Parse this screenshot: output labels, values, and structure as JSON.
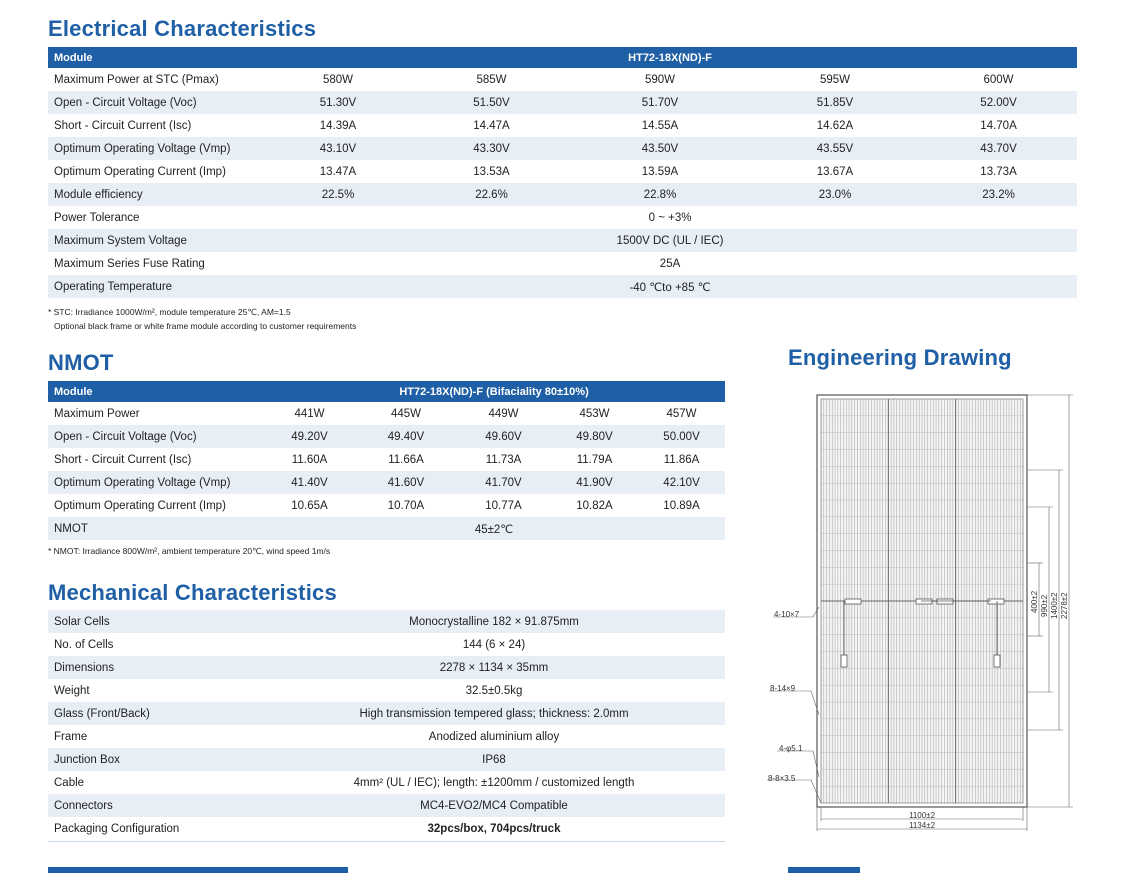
{
  "electrical": {
    "title": "Electrical Characteristics",
    "header": {
      "label": "Module",
      "model": "HT72-18X(ND)-F"
    },
    "rows": [
      {
        "label": "Maximum Power at STC (Pmax)",
        "values": [
          "580W",
          "585W",
          "590W",
          "595W",
          "600W"
        ]
      },
      {
        "label": "Open - Circuit Voltage (Voc)",
        "values": [
          "51.30V",
          "51.50V",
          "51.70V",
          "51.85V",
          "52.00V"
        ]
      },
      {
        "label": "Short - Circuit Current (Isc)",
        "values": [
          "14.39A",
          "14.47A",
          "14.55A",
          "14.62A",
          "14.70A"
        ]
      },
      {
        "label": "Optimum Operating Voltage (Vmp)",
        "values": [
          "43.10V",
          "43.30V",
          "43.50V",
          "43.55V",
          "43.70V"
        ]
      },
      {
        "label": "Optimum Operating Current (Imp)",
        "values": [
          "13.47A",
          "13.53A",
          "13.59A",
          "13.67A",
          "13.73A"
        ]
      },
      {
        "label": "Module efficiency",
        "values": [
          "22.5%",
          "22.6%",
          "22.8%",
          "23.0%",
          "23.2%"
        ]
      }
    ],
    "span_rows": [
      {
        "label": "Power Tolerance",
        "value": "0 ~ +3%"
      },
      {
        "label": "Maximum System Voltage",
        "value": "1500V DC (UL / IEC)"
      },
      {
        "label": "Maximum Series Fuse Rating",
        "value": "25A"
      },
      {
        "label": "Operating Temperature",
        "value": "-40 ℃to +85 ℃"
      }
    ],
    "notes": [
      "* STC: Irradiance 1000W/m², module temperature 25℃, AM=1.5",
      "Optional black frame or white frame module according to customer requirements"
    ]
  },
  "nmot": {
    "title": "NMOT",
    "header": {
      "label": "Module",
      "model": "HT72-18X(ND)-F (Bifaciality 80±10%)"
    },
    "rows": [
      {
        "label": "Maximum Power",
        "values": [
          "441W",
          "445W",
          "449W",
          "453W",
          "457W"
        ]
      },
      {
        "label": "Open - Circuit Voltage (Voc)",
        "values": [
          "49.20V",
          "49.40V",
          "49.60V",
          "49.80V",
          "50.00V"
        ]
      },
      {
        "label": "Short - Circuit Current (Isc)",
        "values": [
          "11.60A",
          "11.66A",
          "11.73A",
          "11.79A",
          "11.86A"
        ]
      },
      {
        "label": "Optimum Operating Voltage (Vmp)",
        "values": [
          "41.40V",
          "41.60V",
          "41.70V",
          "41.90V",
          "42.10V"
        ]
      },
      {
        "label": "Optimum Operating Current (Imp)",
        "values": [
          "10.65A",
          "10.70A",
          "10.77A",
          "10.82A",
          "10.89A"
        ]
      }
    ],
    "span_rows": [
      {
        "label": "NMOT",
        "value": "45±2℃"
      }
    ],
    "notes": [
      "* NMOT: Irradiance 800W/m², ambient temperature 20℃, wind speed 1m/s"
    ]
  },
  "mechanical": {
    "title": "Mechanical Characteristics",
    "rows": [
      {
        "label": "Solar Cells",
        "value": "Monocrystalline 182 × 91.875mm"
      },
      {
        "label": "No. of Cells",
        "value": "144 (6 × 24)"
      },
      {
        "label": "Dimensions",
        "value": "2278 × 1134 × 35mm"
      },
      {
        "label": "Weight",
        "value": "32.5±0.5kg"
      },
      {
        "label": "Glass (Front/Back)",
        "value": "High transmission tempered glass; thickness: 2.0mm"
      },
      {
        "label": "Frame",
        "value": "Anodized aluminium alloy"
      },
      {
        "label": "Junction Box",
        "value": "IP68"
      },
      {
        "label": "Cable",
        "value": "4mm² (UL / IEC); length:  ±1200mm / customized length"
      },
      {
        "label": "Connectors",
        "value": "MC4-EVO2/MC4 Compatible"
      },
      {
        "label": "Packaging Configuration",
        "value": "32pcs/box, 704pcs/truck"
      }
    ]
  },
  "drawing": {
    "title": "Engineering Drawing",
    "labels": {
      "holes_a": "4-10×7",
      "holes_b": "8-14×9",
      "holes_c": "4-φ5.1",
      "holes_d": "8-8×3.5",
      "width_inner": "1100±2",
      "width_outer": "1134±2",
      "dim_400": "400±2",
      "dim_990": "990±2",
      "dim_1400": "1400±2",
      "dim_2278": "2278±2"
    }
  }
}
